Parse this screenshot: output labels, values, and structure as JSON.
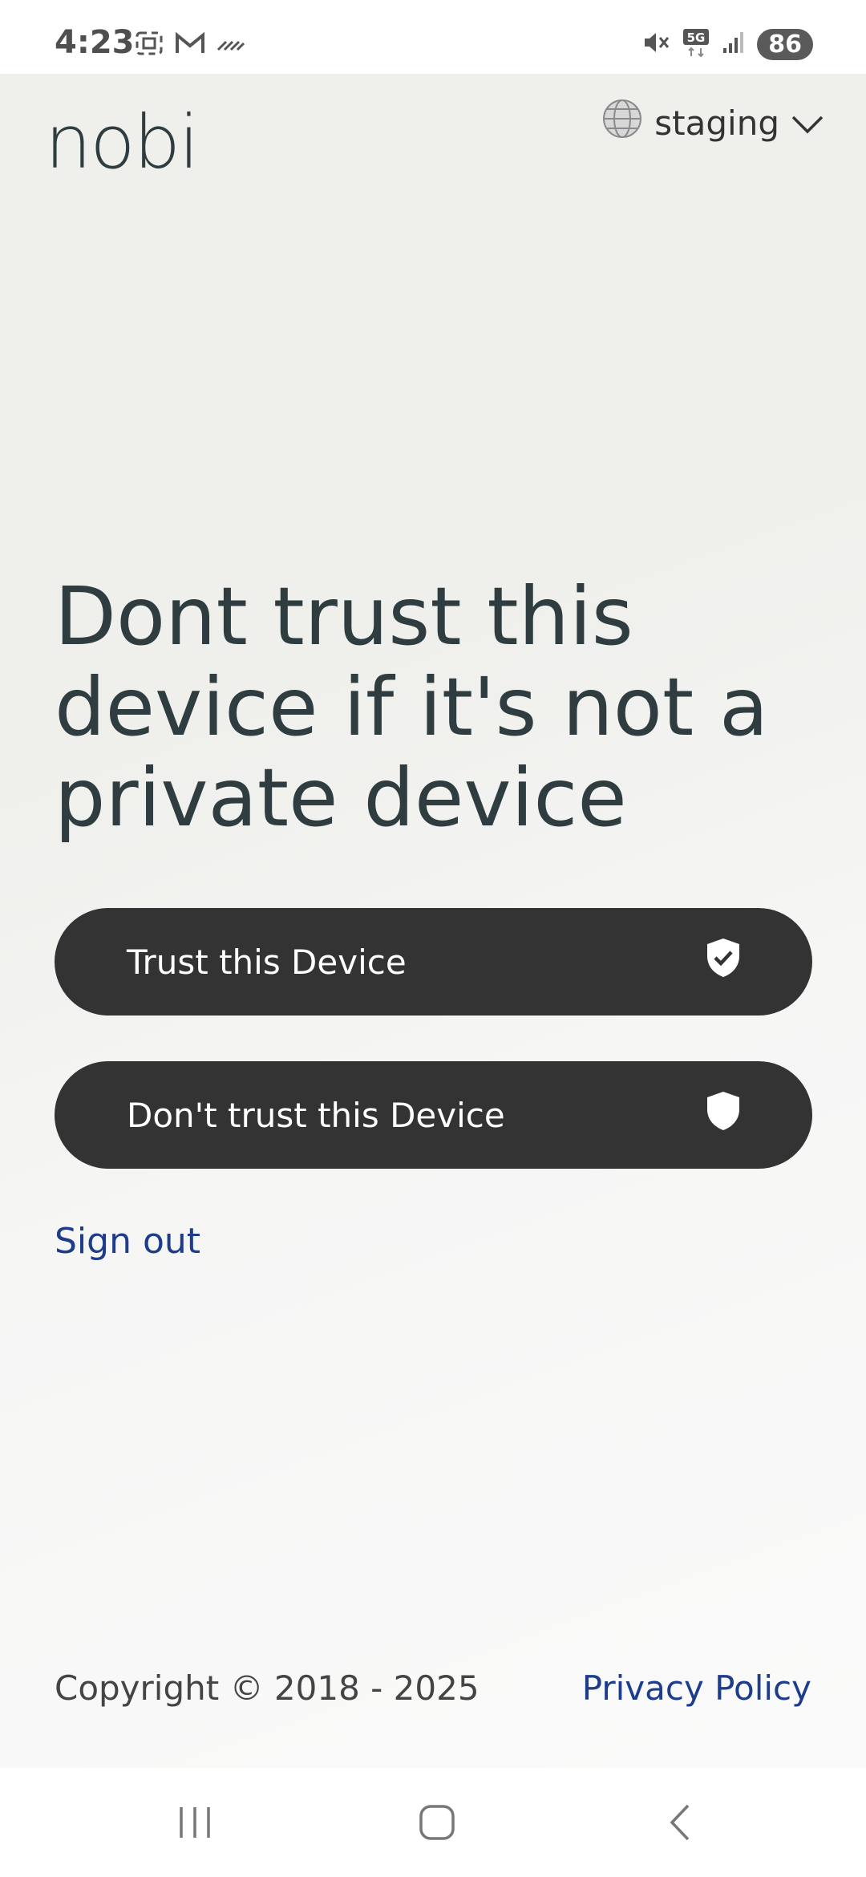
{
  "status_bar": {
    "time": "4:23",
    "battery": "86",
    "network": "5G"
  },
  "header": {
    "logo": "nobi",
    "environment": "staging"
  },
  "main": {
    "headline": "Dont trust this device if it's not a private device",
    "trust_button_label": "Trust this Device",
    "dont_trust_button_label": "Don't trust this Device",
    "sign_out_label": "Sign out"
  },
  "footer": {
    "copyright": "Copyright © 2018 - 2025",
    "privacy_label": "Privacy Policy"
  },
  "colors": {
    "button_bg": "#333333",
    "link": "#1e3c8c",
    "headline": "#2f3d40"
  }
}
